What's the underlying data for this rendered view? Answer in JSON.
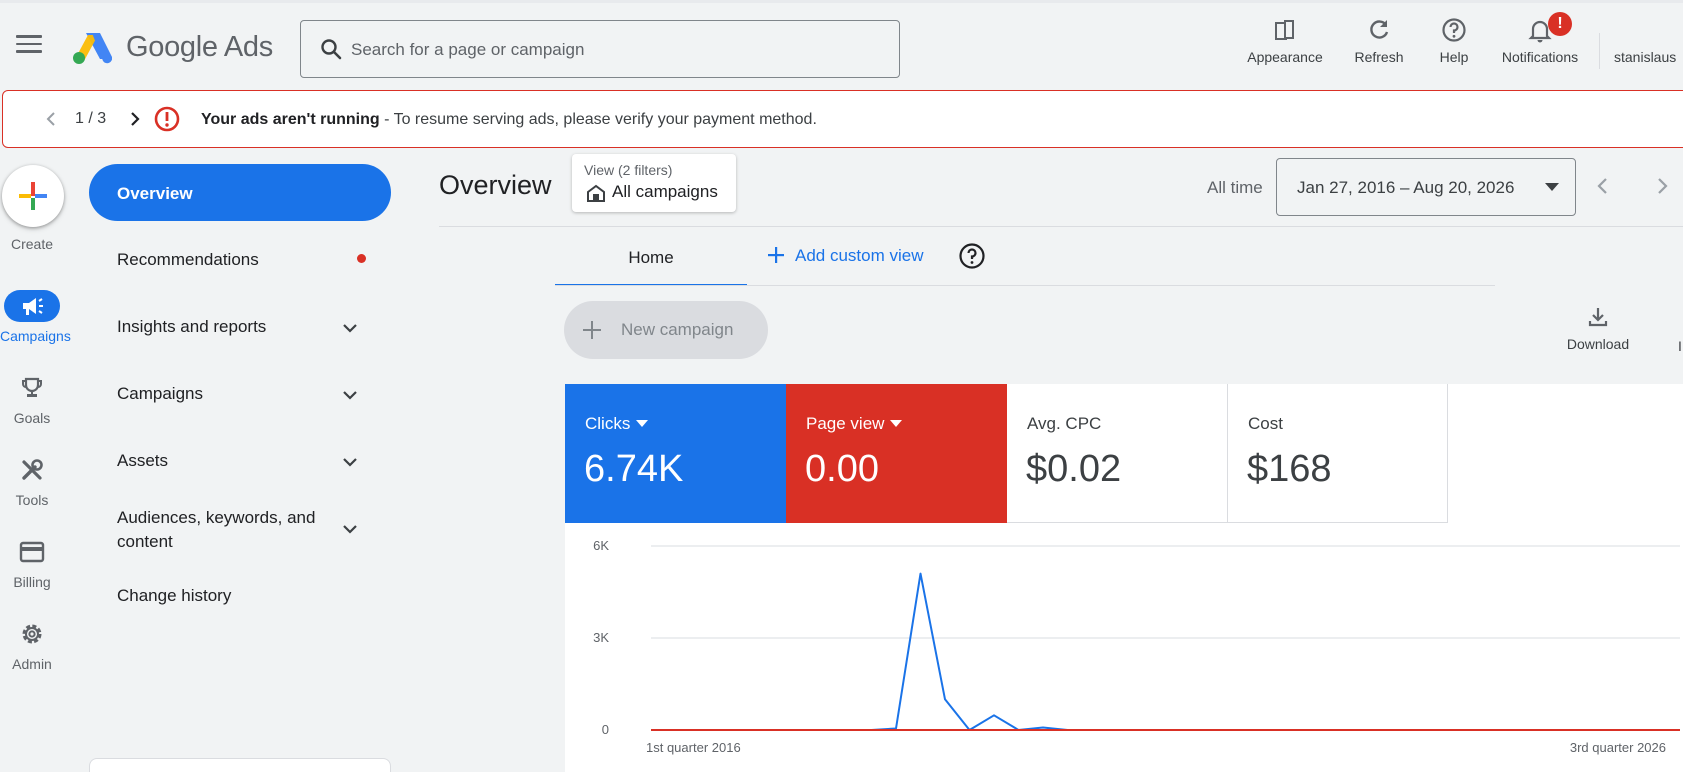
{
  "topbar": {
    "brand": "Google Ads",
    "search_placeholder": "Search for a page or campaign",
    "actions": {
      "appearance": "Appearance",
      "refresh": "Refresh",
      "help": "Help",
      "notifications": "Notifications"
    },
    "notification_badge": "!",
    "account": "stanislaus"
  },
  "alert": {
    "pager": "1 / 3",
    "title": "Your ads aren't running",
    "message": " - To resume serving ads, please verify your payment method."
  },
  "rail": {
    "create": "Create",
    "campaigns": "Campaigns",
    "goals": "Goals",
    "tools": "Tools",
    "billing": "Billing",
    "admin": "Admin"
  },
  "nav": {
    "overview": "Overview",
    "recommendations": "Recommendations",
    "insights": "Insights and reports",
    "campaigns": "Campaigns",
    "assets": "Assets",
    "audiences_line1": "Audiences, keywords, and",
    "audiences_line2": "content",
    "change_history": "Change history"
  },
  "main": {
    "title": "Overview",
    "view_label": "View (2 filters)",
    "view_value": "All campaigns",
    "all_time": "All time",
    "date_range": "Jan 27, 2016 – Aug 20, 2026"
  },
  "tabs": {
    "home": "Home",
    "add_custom_view": "Add custom view"
  },
  "toolbar": {
    "new_campaign": "New campaign",
    "download": "Download",
    "edge_letter": "I"
  },
  "metrics": [
    {
      "label": "Clicks",
      "value": "6.74K"
    },
    {
      "label": "Page view",
      "value": "0.00"
    },
    {
      "label": "Avg. CPC",
      "value": "$0.02"
    },
    {
      "label": "Cost",
      "value": "$168"
    }
  ],
  "colors": {
    "accent": "#1a73e8",
    "alert": "#d93025"
  },
  "chart_data": {
    "type": "line",
    "x_start_label": "1st quarter 2016",
    "x_end_label": "3rd quarter 2026",
    "ytick_labels": [
      "6K",
      "3K",
      "0"
    ],
    "ylim": [
      0,
      6000
    ],
    "grid": true,
    "series": [
      {
        "name": "Clicks",
        "color": "#1a73e8",
        "values": [
          0,
          0,
          0,
          0,
          0,
          0,
          0,
          0,
          0,
          0,
          50,
          5100,
          1000,
          0,
          480,
          0,
          80,
          0,
          0,
          0,
          0,
          0,
          0,
          0,
          0,
          0,
          0,
          0,
          0,
          0,
          0,
          0,
          0,
          0,
          0,
          0,
          0,
          0,
          0,
          0,
          0,
          0,
          0
        ]
      },
      {
        "name": "Page view",
        "color": "#d93025",
        "values": [
          0,
          0,
          0,
          0,
          0,
          0,
          0,
          0,
          0,
          0,
          0,
          0,
          0,
          0,
          0,
          0,
          0,
          0,
          0,
          0,
          0,
          0,
          0,
          0,
          0,
          0,
          0,
          0,
          0,
          0,
          0,
          0,
          0,
          0,
          0,
          0,
          0,
          0,
          0,
          0,
          0,
          0,
          0
        ]
      }
    ]
  }
}
